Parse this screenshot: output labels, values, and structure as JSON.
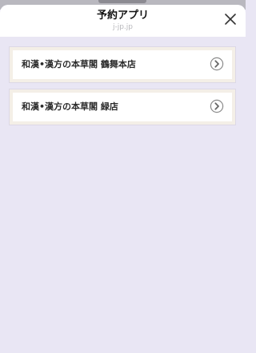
{
  "header": {
    "title": "予約アプリ",
    "subtitle": "j-jp.jp"
  },
  "icons": {
    "close": "close-icon",
    "chevron": "chevron-right-circle-icon"
  },
  "colors": {
    "background": "#e9e6f4",
    "card_border": "#f4efe7",
    "text": "#2b2b2b"
  },
  "stores": [
    {
      "label": "和漢•漢方の本草閣 鶴舞本店"
    },
    {
      "label": "和漢•漢方の本草閣 緑店"
    }
  ]
}
